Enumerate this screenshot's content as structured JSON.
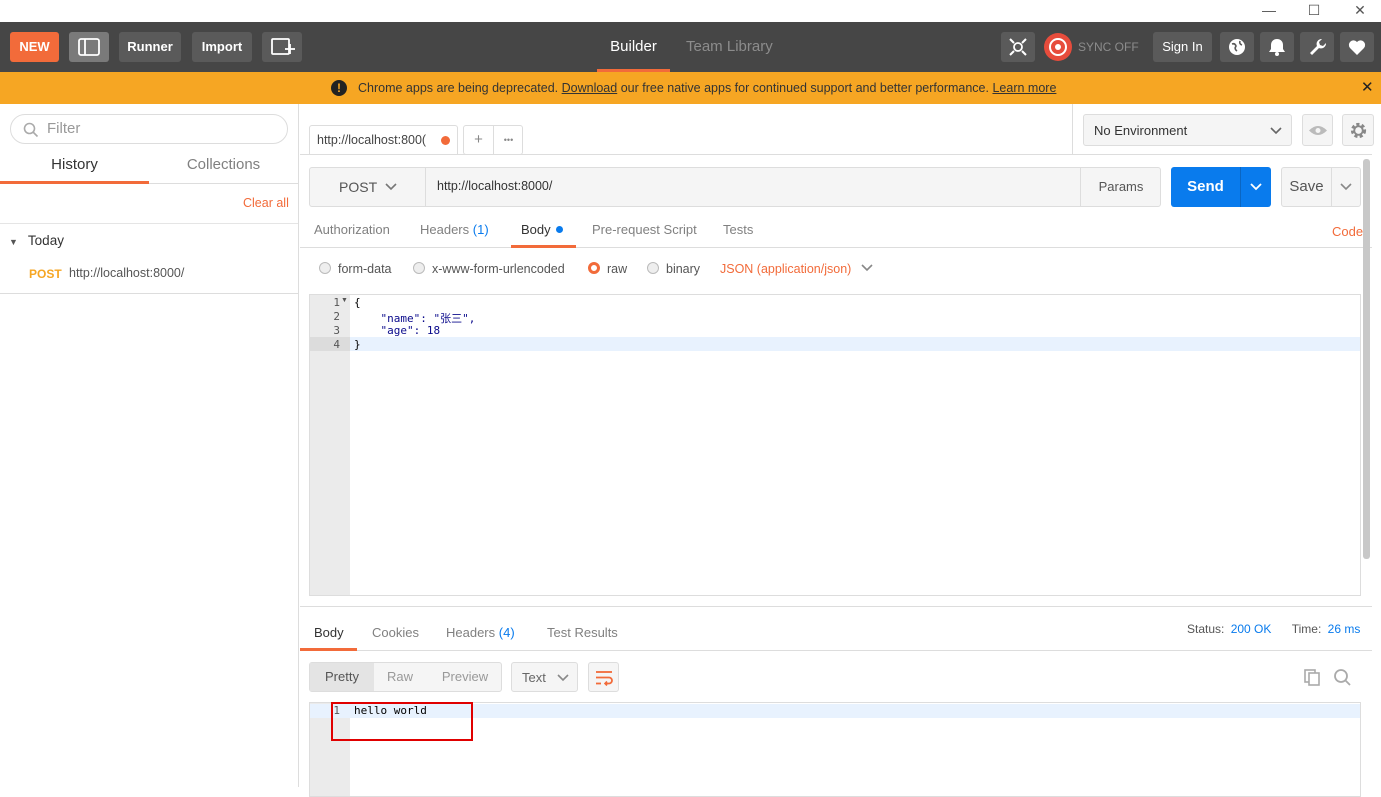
{
  "window": {
    "minimize": "—",
    "maximize": "☐",
    "close": "✕"
  },
  "header": {
    "new_label": "NEW",
    "runner_label": "Runner",
    "import_label": "Import",
    "tabs": [
      {
        "label": "Builder"
      },
      {
        "label": "Team Library"
      }
    ],
    "sync_label": "SYNC OFF",
    "signin_label": "Sign In"
  },
  "banner": {
    "prefix": "Chrome apps are being deprecated.",
    "link1": "Download",
    "middle": "our free native apps for continued support and better performance.",
    "link2": "Learn more",
    "close": "✕"
  },
  "sidebar": {
    "filter_placeholder": "Filter",
    "tabs": [
      {
        "label": "History"
      },
      {
        "label": "Collections"
      }
    ],
    "clear_all": "Clear all",
    "group_label": "Today",
    "items": [
      {
        "method": "POST",
        "url": "http://localhost:8000/"
      }
    ]
  },
  "request_tabs": [
    {
      "label": "http://localhost:800("
    }
  ],
  "request_tab_add": "+",
  "request_tab_more": "•••",
  "environment": {
    "selected": "No Environment"
  },
  "request": {
    "method": "POST",
    "url": "http://localhost:8000/",
    "params_label": "Params",
    "send_label": "Send",
    "save_label": "Save"
  },
  "request_subtabs": {
    "authorization": "Authorization",
    "headers": "Headers",
    "headers_count": "(1)",
    "body": "Body",
    "prerequest": "Pre-request Script",
    "tests": "Tests",
    "code": "Code"
  },
  "body_modes": {
    "form_data": "form-data",
    "urlencoded": "x-www-form-urlencoded",
    "raw": "raw",
    "binary": "binary",
    "content_type": "JSON (application/json)"
  },
  "request_body": {
    "line_numbers": [
      "1",
      "2",
      "3",
      "4"
    ],
    "lines": [
      "{",
      "    \"name\": \"张三\",",
      "    \"age\": 18",
      "}"
    ]
  },
  "response": {
    "tabs": {
      "body": "Body",
      "cookies": "Cookies",
      "headers": "Headers",
      "headers_count": "(4)",
      "test_results": "Test Results"
    },
    "status_label": "Status:",
    "status_value": "200 OK",
    "time_label": "Time:",
    "time_value": "26 ms",
    "view_modes": {
      "pretty": "Pretty",
      "raw": "Raw",
      "preview": "Preview"
    },
    "format": "Text",
    "line_numbers": [
      "1"
    ],
    "lines": [
      "hello world"
    ]
  },
  "colors": {
    "accent": "#f26b3a",
    "send_button": "#097bed",
    "banner": "#f6a623",
    "header": "#464646",
    "link_blue": "#097bed",
    "highlight_box": "#e00000"
  }
}
